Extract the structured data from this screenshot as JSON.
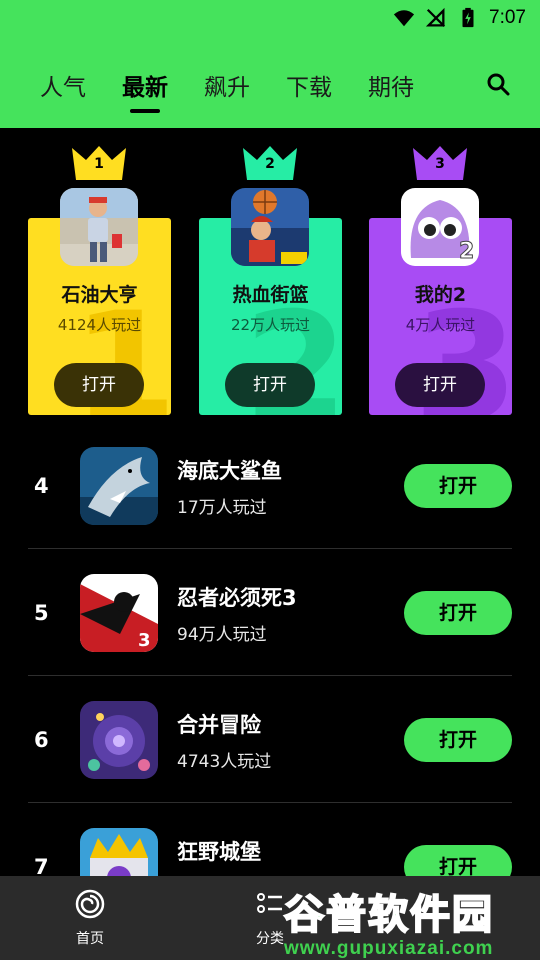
{
  "status": {
    "time": "7:07"
  },
  "tabs": [
    {
      "label": "人气"
    },
    {
      "label": "最新"
    },
    {
      "label": "飙升"
    },
    {
      "label": "下载"
    },
    {
      "label": "期待"
    }
  ],
  "active_tab": "最新",
  "podium": [
    {
      "rank": "1",
      "name": "石油大亨",
      "plays": "4124人玩过",
      "button": "打开",
      "color": "#ffde21"
    },
    {
      "rank": "2",
      "name": "热血街篮",
      "plays": "22万人玩过",
      "button": "打开",
      "color": "#26eda5"
    },
    {
      "rank": "3",
      "name": "我的2",
      "plays": "4万人玩过",
      "button": "打开",
      "color": "#a84cf4"
    }
  ],
  "list": [
    {
      "rank": "4",
      "name": "海底大鲨鱼",
      "plays": "17万人玩过",
      "button": "打开"
    },
    {
      "rank": "5",
      "name": "忍者必须死3",
      "plays": "94万人玩过",
      "button": "打开"
    },
    {
      "rank": "6",
      "name": "合并冒险",
      "plays": "4743人玩过",
      "button": "打开"
    },
    {
      "rank": "7",
      "name": "狂野城堡",
      "plays": "",
      "button": "打开"
    }
  ],
  "bottom_nav": [
    {
      "label": "首页",
      "icon": "home-swirl-icon"
    },
    {
      "label": "分类",
      "icon": "category-list-icon"
    }
  ],
  "watermark": {
    "text": "谷普软件园",
    "url": "www.gupuxiazai.com"
  },
  "colors": {
    "accent": "#45e35c",
    "background": "#000000",
    "nav": "#2b2b2b"
  }
}
